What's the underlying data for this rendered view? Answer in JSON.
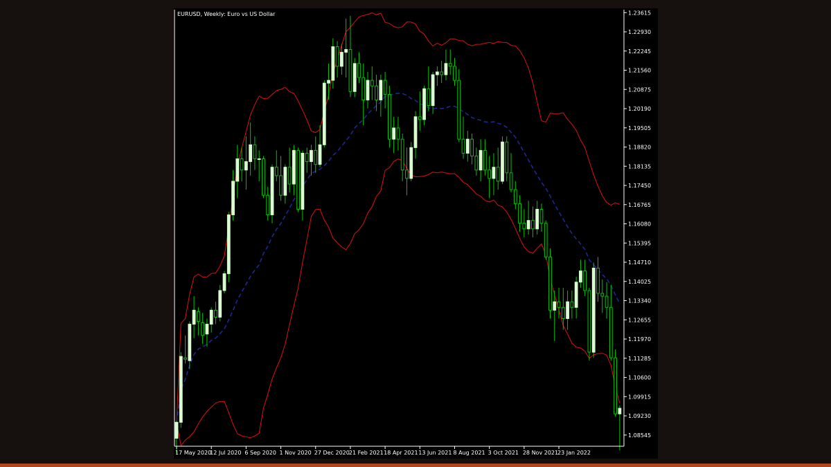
{
  "window": {
    "title": "EURUSD, Weekly:  Euro vs US Dollar"
  },
  "colors": {
    "background": "#000000",
    "page_background": "#16110e",
    "bull_body": "#d8fbd0",
    "bear_body": "#000000",
    "wick": "#00c800",
    "band": "#e01010",
    "middle_line": "#1e2a9a",
    "axis": "#ffffff",
    "accent_bar": "#b0461f"
  },
  "chart_data": {
    "type": "candlestick",
    "title": "EURUSD, Weekly:  Euro vs US Dollar",
    "symbol": "EURUSD",
    "timeframe": "Weekly",
    "description": "Euro vs US Dollar",
    "x_tick_labels": [
      "17 May 2020",
      "12 Jul 2020",
      "6 Sep 2020",
      "1 Nov 2020",
      "27 Dec 2020",
      "21 Feb 2021",
      "18 Apr 2021",
      "13 Jun 2021",
      "8 Aug 2021",
      "3 Oct 2021",
      "28 Nov 2021",
      "23 Jan 2022"
    ],
    "y_tick_labels": [
      "1.23615",
      "1.22930",
      "1.22245",
      "1.21560",
      "1.20875",
      "1.20190",
      "1.19505",
      "1.18820",
      "1.18135",
      "1.17450",
      "1.16765",
      "1.16080",
      "1.15395",
      "1.14710",
      "1.14025",
      "1.13340",
      "1.12655",
      "1.11970",
      "1.11285",
      "1.10600",
      "1.09915",
      "1.09230",
      "1.08545"
    ],
    "ylim": [
      1.0817,
      1.2372
    ],
    "grid": false,
    "indicator": "Bollinger Bands",
    "candles": [
      {
        "o": 1.0843,
        "h": 1.0905,
        "l": 1.079,
        "c": 1.09
      },
      {
        "o": 1.09,
        "h": 1.115,
        "l": 1.088,
        "c": 1.1135
      },
      {
        "o": 1.113,
        "h": 1.121,
        "l": 1.111,
        "c": 1.1125
      },
      {
        "o": 1.112,
        "h": 1.126,
        "l": 1.109,
        "c": 1.125
      },
      {
        "o": 1.125,
        "h": 1.135,
        "l": 1.12,
        "c": 1.13
      },
      {
        "o": 1.1295,
        "h": 1.131,
        "l": 1.121,
        "c": 1.126
      },
      {
        "o": 1.1255,
        "h": 1.129,
        "l": 1.118,
        "c": 1.121
      },
      {
        "o": 1.1215,
        "h": 1.127,
        "l": 1.117,
        "c": 1.125
      },
      {
        "o": 1.125,
        "h": 1.131,
        "l": 1.122,
        "c": 1.13
      },
      {
        "o": 1.13,
        "h": 1.133,
        "l": 1.125,
        "c": 1.1275
      },
      {
        "o": 1.1275,
        "h": 1.139,
        "l": 1.126,
        "c": 1.137
      },
      {
        "o": 1.137,
        "h": 1.144,
        "l": 1.136,
        "c": 1.143
      },
      {
        "o": 1.143,
        "h": 1.165,
        "l": 1.14,
        "c": 1.164
      },
      {
        "o": 1.164,
        "h": 1.18,
        "l": 1.162,
        "c": 1.176
      },
      {
        "o": 1.176,
        "h": 1.189,
        "l": 1.17,
        "c": 1.184
      },
      {
        "o": 1.184,
        "h": 1.188,
        "l": 1.176,
        "c": 1.18
      },
      {
        "o": 1.18,
        "h": 1.192,
        "l": 1.173,
        "c": 1.183
      },
      {
        "o": 1.183,
        "h": 1.197,
        "l": 1.178,
        "c": 1.189
      },
      {
        "o": 1.189,
        "h": 1.192,
        "l": 1.18,
        "c": 1.184
      },
      {
        "o": 1.184,
        "h": 1.187,
        "l": 1.176,
        "c": 1.184
      },
      {
        "o": 1.184,
        "h": 1.185,
        "l": 1.17,
        "c": 1.171
      },
      {
        "o": 1.171,
        "h": 1.174,
        "l": 1.162,
        "c": 1.164
      },
      {
        "o": 1.164,
        "h": 1.182,
        "l": 1.161,
        "c": 1.181
      },
      {
        "o": 1.181,
        "h": 1.187,
        "l": 1.176,
        "c": 1.178
      },
      {
        "o": 1.178,
        "h": 1.185,
        "l": 1.169,
        "c": 1.171
      },
      {
        "o": 1.171,
        "h": 1.182,
        "l": 1.168,
        "c": 1.181
      },
      {
        "o": 1.181,
        "h": 1.188,
        "l": 1.172,
        "c": 1.175
      },
      {
        "o": 1.175,
        "h": 1.189,
        "l": 1.171,
        "c": 1.187
      },
      {
        "o": 1.187,
        "h": 1.188,
        "l": 1.165,
        "c": 1.166
      },
      {
        "o": 1.166,
        "h": 1.187,
        "l": 1.162,
        "c": 1.186
      },
      {
        "o": 1.186,
        "h": 1.188,
        "l": 1.179,
        "c": 1.183
      },
      {
        "o": 1.183,
        "h": 1.189,
        "l": 1.178,
        "c": 1.187
      },
      {
        "o": 1.187,
        "h": 1.192,
        "l": 1.179,
        "c": 1.182
      },
      {
        "o": 1.182,
        "h": 1.196,
        "l": 1.181,
        "c": 1.189
      },
      {
        "o": 1.189,
        "h": 1.212,
        "l": 1.188,
        "c": 1.211
      },
      {
        "o": 1.211,
        "h": 1.218,
        "l": 1.205,
        "c": 1.212
      },
      {
        "o": 1.212,
        "h": 1.227,
        "l": 1.209,
        "c": 1.224
      },
      {
        "o": 1.224,
        "h": 1.226,
        "l": 1.213,
        "c": 1.217
      },
      {
        "o": 1.217,
        "h": 1.225,
        "l": 1.214,
        "c": 1.222
      },
      {
        "o": 1.222,
        "h": 1.234,
        "l": 1.213,
        "c": 1.223
      },
      {
        "o": 1.223,
        "h": 1.235,
        "l": 1.206,
        "c": 1.208
      },
      {
        "o": 1.208,
        "h": 1.22,
        "l": 1.206,
        "c": 1.218
      },
      {
        "o": 1.218,
        "h": 1.222,
        "l": 1.211,
        "c": 1.213
      },
      {
        "o": 1.213,
        "h": 1.218,
        "l": 1.196,
        "c": 1.205
      },
      {
        "o": 1.205,
        "h": 1.215,
        "l": 1.202,
        "c": 1.212
      },
      {
        "o": 1.212,
        "h": 1.217,
        "l": 1.205,
        "c": 1.21
      },
      {
        "o": 1.21,
        "h": 1.214,
        "l": 1.201,
        "c": 1.205
      },
      {
        "o": 1.205,
        "h": 1.214,
        "l": 1.199,
        "c": 1.212
      },
      {
        "o": 1.212,
        "h": 1.215,
        "l": 1.202,
        "c": 1.207
      },
      {
        "o": 1.207,
        "h": 1.21,
        "l": 1.188,
        "c": 1.191
      },
      {
        "o": 1.191,
        "h": 1.199,
        "l": 1.186,
        "c": 1.195
      },
      {
        "o": 1.195,
        "h": 1.199,
        "l": 1.187,
        "c": 1.191
      },
      {
        "o": 1.191,
        "h": 1.193,
        "l": 1.176,
        "c": 1.18
      },
      {
        "o": 1.18,
        "h": 1.188,
        "l": 1.171,
        "c": 1.177
      },
      {
        "o": 1.177,
        "h": 1.19,
        "l": 1.176,
        "c": 1.188
      },
      {
        "o": 1.188,
        "h": 1.201,
        "l": 1.184,
        "c": 1.199
      },
      {
        "o": 1.199,
        "h": 1.208,
        "l": 1.194,
        "c": 1.198
      },
      {
        "o": 1.198,
        "h": 1.21,
        "l": 1.196,
        "c": 1.209
      },
      {
        "o": 1.209,
        "h": 1.217,
        "l": 1.201,
        "c": 1.203
      },
      {
        "o": 1.203,
        "h": 1.215,
        "l": 1.2,
        "c": 1.214
      },
      {
        "o": 1.214,
        "h": 1.217,
        "l": 1.21,
        "c": 1.215
      },
      {
        "o": 1.215,
        "h": 1.219,
        "l": 1.211,
        "c": 1.214
      },
      {
        "o": 1.214,
        "h": 1.223,
        "l": 1.212,
        "c": 1.218
      },
      {
        "o": 1.218,
        "h": 1.223,
        "l": 1.214,
        "c": 1.217
      },
      {
        "o": 1.217,
        "h": 1.22,
        "l": 1.21,
        "c": 1.212
      },
      {
        "o": 1.212,
        "h": 1.216,
        "l": 1.19,
        "c": 1.191
      },
      {
        "o": 1.191,
        "h": 1.199,
        "l": 1.184,
        "c": 1.186
      },
      {
        "o": 1.186,
        "h": 1.194,
        "l": 1.183,
        "c": 1.191
      },
      {
        "o": 1.191,
        "h": 1.193,
        "l": 1.182,
        "c": 1.185
      },
      {
        "o": 1.185,
        "h": 1.188,
        "l": 1.178,
        "c": 1.18
      },
      {
        "o": 1.18,
        "h": 1.191,
        "l": 1.176,
        "c": 1.187
      },
      {
        "o": 1.187,
        "h": 1.191,
        "l": 1.178,
        "c": 1.18
      },
      {
        "o": 1.18,
        "h": 1.185,
        "l": 1.17,
        "c": 1.177
      },
      {
        "o": 1.177,
        "h": 1.186,
        "l": 1.171,
        "c": 1.181
      },
      {
        "o": 1.181,
        "h": 1.188,
        "l": 1.173,
        "c": 1.176
      },
      {
        "o": 1.176,
        "h": 1.192,
        "l": 1.175,
        "c": 1.19
      },
      {
        "o": 1.19,
        "h": 1.192,
        "l": 1.176,
        "c": 1.179
      },
      {
        "o": 1.179,
        "h": 1.186,
        "l": 1.172,
        "c": 1.173
      },
      {
        "o": 1.173,
        "h": 1.176,
        "l": 1.166,
        "c": 1.168
      },
      {
        "o": 1.168,
        "h": 1.171,
        "l": 1.158,
        "c": 1.161
      },
      {
        "o": 1.161,
        "h": 1.166,
        "l": 1.156,
        "c": 1.159
      },
      {
        "o": 1.159,
        "h": 1.169,
        "l": 1.157,
        "c": 1.162
      },
      {
        "o": 1.162,
        "h": 1.167,
        "l": 1.156,
        "c": 1.159
      },
      {
        "o": 1.159,
        "h": 1.169,
        "l": 1.157,
        "c": 1.166
      },
      {
        "o": 1.166,
        "h": 1.168,
        "l": 1.158,
        "c": 1.161
      },
      {
        "o": 1.161,
        "h": 1.162,
        "l": 1.148,
        "c": 1.149
      },
      {
        "o": 1.149,
        "h": 1.152,
        "l": 1.127,
        "c": 1.13
      },
      {
        "o": 1.13,
        "h": 1.137,
        "l": 1.119,
        "c": 1.133
      },
      {
        "o": 1.133,
        "h": 1.138,
        "l": 1.127,
        "c": 1.131
      },
      {
        "o": 1.131,
        "h": 1.138,
        "l": 1.123,
        "c": 1.127
      },
      {
        "o": 1.127,
        "h": 1.137,
        "l": 1.123,
        "c": 1.133
      },
      {
        "o": 1.133,
        "h": 1.137,
        "l": 1.127,
        "c": 1.131
      },
      {
        "o": 1.131,
        "h": 1.142,
        "l": 1.127,
        "c": 1.14
      },
      {
        "o": 1.14,
        "h": 1.148,
        "l": 1.138,
        "c": 1.144
      },
      {
        "o": 1.144,
        "h": 1.148,
        "l": 1.135,
        "c": 1.137
      },
      {
        "o": 1.137,
        "h": 1.138,
        "l": 1.112,
        "c": 1.115
      },
      {
        "o": 1.115,
        "h": 1.147,
        "l": 1.113,
        "c": 1.145
      },
      {
        "o": 1.145,
        "h": 1.149,
        "l": 1.133,
        "c": 1.136
      },
      {
        "o": 1.136,
        "h": 1.141,
        "l": 1.129,
        "c": 1.135
      },
      {
        "o": 1.135,
        "h": 1.14,
        "l": 1.127,
        "c": 1.131
      },
      {
        "o": 1.131,
        "h": 1.139,
        "l": 1.112,
        "c": 1.113
      },
      {
        "o": 1.113,
        "h": 1.116,
        "l": 1.092,
        "c": 1.093
      },
      {
        "o": 1.093,
        "h": 1.096,
        "l": 1.08,
        "c": 1.095
      }
    ],
    "upper_band": [
      1.116,
      1.117,
      1.122,
      1.129,
      1.133,
      1.134,
      1.133,
      1.133,
      1.136,
      1.137,
      1.142,
      1.147,
      1.162,
      1.178,
      1.192,
      1.196,
      1.199,
      1.202,
      1.203,
      1.201,
      1.199,
      1.197,
      1.198,
      1.197,
      1.198,
      1.197,
      1.197,
      1.198,
      1.197,
      1.199,
      1.203,
      1.208,
      1.212,
      1.216,
      1.22,
      1.224,
      1.226,
      1.228,
      1.229,
      1.23,
      1.23,
      1.229,
      1.229,
      1.227,
      1.224,
      1.22,
      1.216,
      1.213,
      1.21,
      1.209,
      1.208,
      1.209,
      1.211,
      1.214,
      1.217,
      1.22,
      1.223,
      1.225,
      1.225,
      1.224,
      1.222,
      1.218,
      1.214,
      1.21,
      1.206,
      1.202,
      1.199,
      1.197,
      1.195,
      1.194,
      1.193,
      1.192,
      1.19,
      1.188,
      1.186,
      1.184,
      1.182,
      1.178,
      1.174,
      1.17,
      1.165,
      1.161,
      1.157,
      1.153,
      1.149,
      1.147,
      1.147,
      1.147,
      1.148,
      1.148,
      1.148,
      1.148,
      1.148,
      1.148,
      1.147,
      1.146
    ]
  },
  "y_axis": {
    "labels": [
      "1.23615",
      "1.22930",
      "1.22245",
      "1.21560",
      "1.20875",
      "1.20190",
      "1.19505",
      "1.18820",
      "1.18135",
      "1.17450",
      "1.16765",
      "1.16080",
      "1.15395",
      "1.14710",
      "1.14025",
      "1.13340",
      "1.12655",
      "1.11970",
      "1.11285",
      "1.10600",
      "1.09915",
      "1.09230",
      "1.08545"
    ]
  },
  "x_axis": {
    "labels": [
      "17 May 2020",
      "12 Jul 2020",
      "6 Sep 2020",
      "1 Nov 2020",
      "27 Dec 2020",
      "21 Feb 2021",
      "18 Apr 2021",
      "13 Jun 2021",
      "8 Aug 2021",
      "3 Oct 2021",
      "28 Nov 2021",
      "23 Jan 2022"
    ]
  }
}
